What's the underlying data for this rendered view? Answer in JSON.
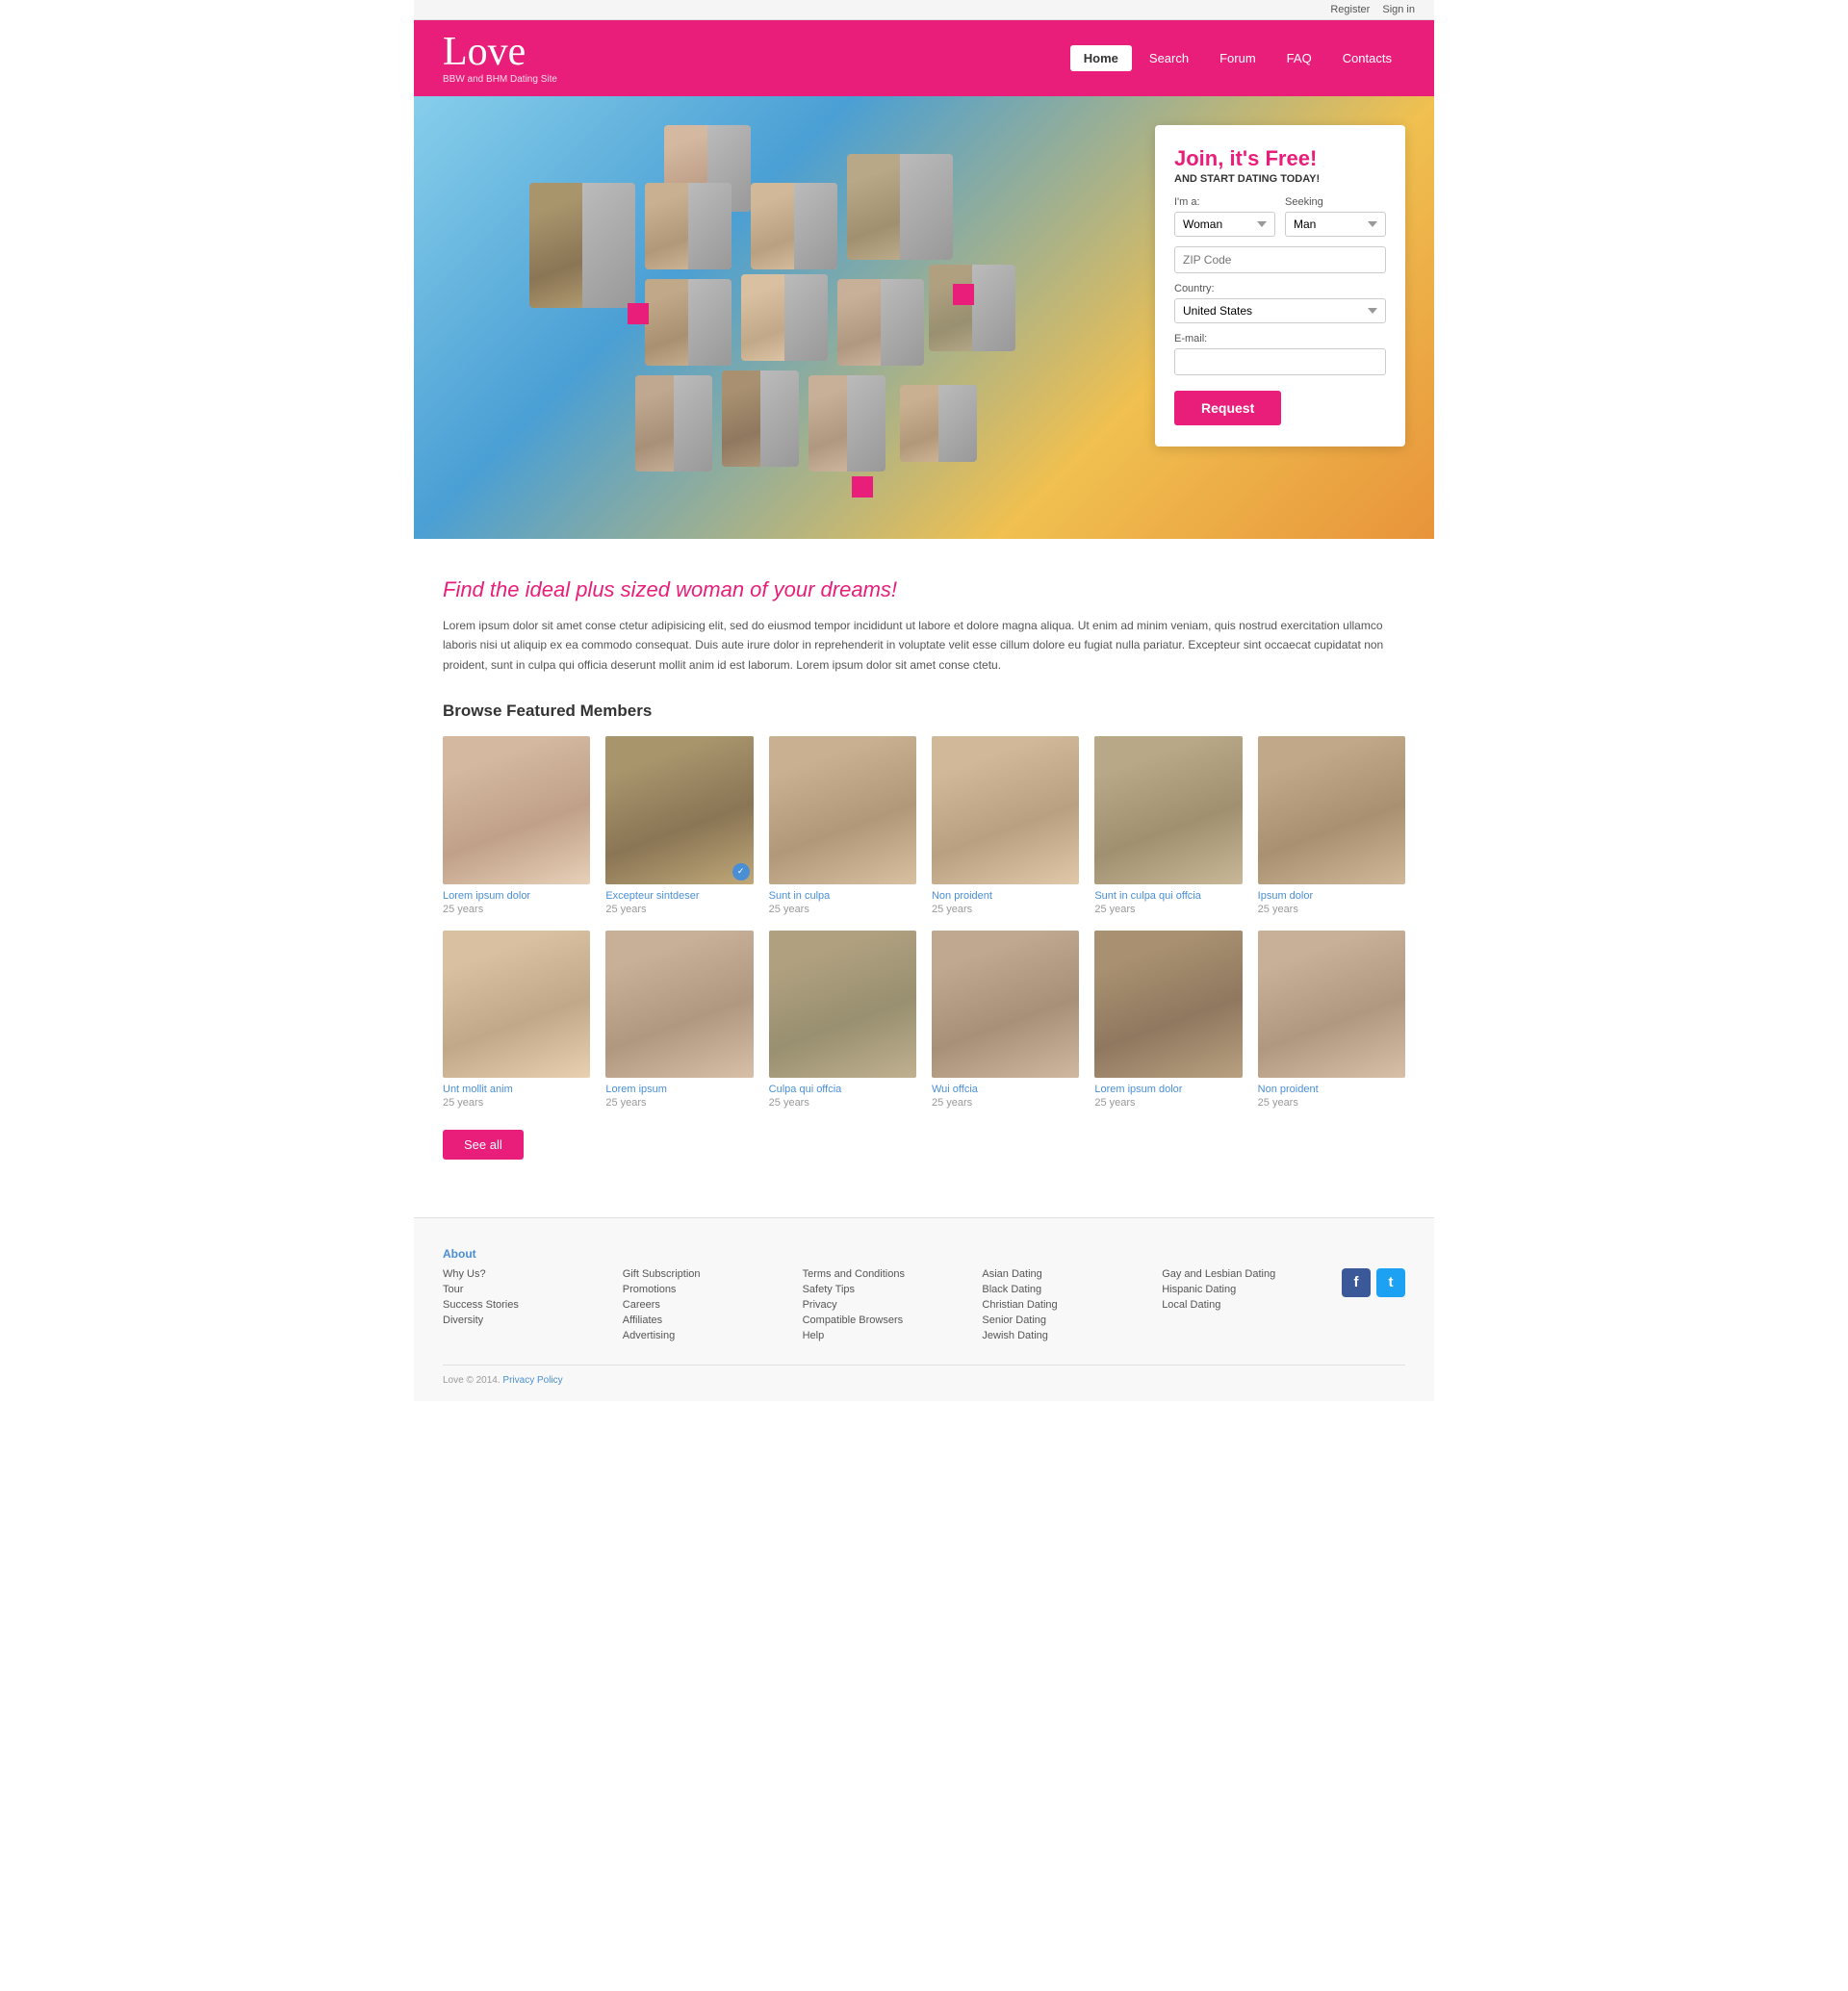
{
  "topbar": {
    "register": "Register",
    "signin": "Sign in"
  },
  "header": {
    "logo": "Love",
    "tagline": "BBW and BHM Dating Site",
    "nav": [
      {
        "label": "Home",
        "active": true
      },
      {
        "label": "Search",
        "active": false
      },
      {
        "label": "Forum",
        "active": false
      },
      {
        "label": "FAQ",
        "active": false
      },
      {
        "label": "Contacts",
        "active": false
      }
    ]
  },
  "hero": {
    "join_title": "Join, it's Free!",
    "join_subtitle": "AND START DATING TODAY!",
    "im_a_label": "I'm a:",
    "seeking_label": "Seeking",
    "im_a_value": "Woman",
    "seeking_value": "Man",
    "zip_placeholder": "ZIP Code",
    "country_label": "Country:",
    "country_value": "United States",
    "email_label": "E-mail:",
    "email_placeholder": "",
    "request_btn": "Request"
  },
  "content": {
    "tagline": "Find the ideal plus sized woman of your dreams!",
    "description": "Lorem ipsum dolor sit amet conse ctetur adipisicing elit, sed do eiusmod tempor incididunt ut labore et dolore magna aliqua. Ut enim ad minim veniam, quis nostrud exercitation ullamco laboris nisi ut aliquip ex ea commodo consequat. Duis aute irure dolor in reprehenderit in voluptate velit esse cillum dolore eu fugiat nulla pariatur. Excepteur sint occaecat cupidatat non proident, sunt in culpa qui officia deserunt mollit anim id est laborum. Lorem ipsum dolor sit amet conse ctetu.",
    "featured_title": "Browse Featured Members",
    "members_row1": [
      {
        "name": "Lorem ipsum dolor",
        "age": "25 years",
        "badge": false
      },
      {
        "name": "Excepteur sintdeser",
        "age": "25 years",
        "badge": true
      },
      {
        "name": "Sunt in culpa",
        "age": "25 years",
        "badge": false
      },
      {
        "name": "Non proident",
        "age": "25 years",
        "badge": false
      },
      {
        "name": "Sunt in culpa qui offcia",
        "age": "25 years",
        "badge": false
      },
      {
        "name": "Ipsum dolor",
        "age": "25 years",
        "badge": false
      }
    ],
    "members_row2": [
      {
        "name": "Unt mollit anim",
        "age": "25 years",
        "badge": false
      },
      {
        "name": "Lorem ipsum",
        "age": "25 years",
        "badge": false
      },
      {
        "name": "Culpa qui offcia",
        "age": "25 years",
        "badge": false
      },
      {
        "name": "Wui offcia",
        "age": "25 years",
        "badge": false
      },
      {
        "name": "Lorem ipsum dolor",
        "age": "25 years",
        "badge": false
      },
      {
        "name": "Non proident",
        "age": "25 years",
        "badge": false
      }
    ],
    "see_all_btn": "See all"
  },
  "footer": {
    "col1_title": "About",
    "col1_links": [
      "Why Us?",
      "Tour",
      "Success Stories",
      "Diversity"
    ],
    "col2_title": "",
    "col2_links": [
      "Gift Subscription",
      "Promotions",
      "Careers",
      "Affiliates",
      "Advertising"
    ],
    "col3_title": "",
    "col3_links": [
      "Terms and Conditions",
      "Safety Tips",
      "Privacy",
      "Compatible Browsers",
      "Help"
    ],
    "col4_title": "",
    "col4_links": [
      "Asian Dating",
      "Black Dating",
      "Christian Dating",
      "Senior Dating",
      "Jewish Dating"
    ],
    "col5_title": "",
    "col5_links": [
      "Gay and Lesbian Dating",
      "Hispanic Dating",
      "Local Dating"
    ],
    "copyright": "Love © 2014.",
    "privacy": "Privacy Policy"
  }
}
